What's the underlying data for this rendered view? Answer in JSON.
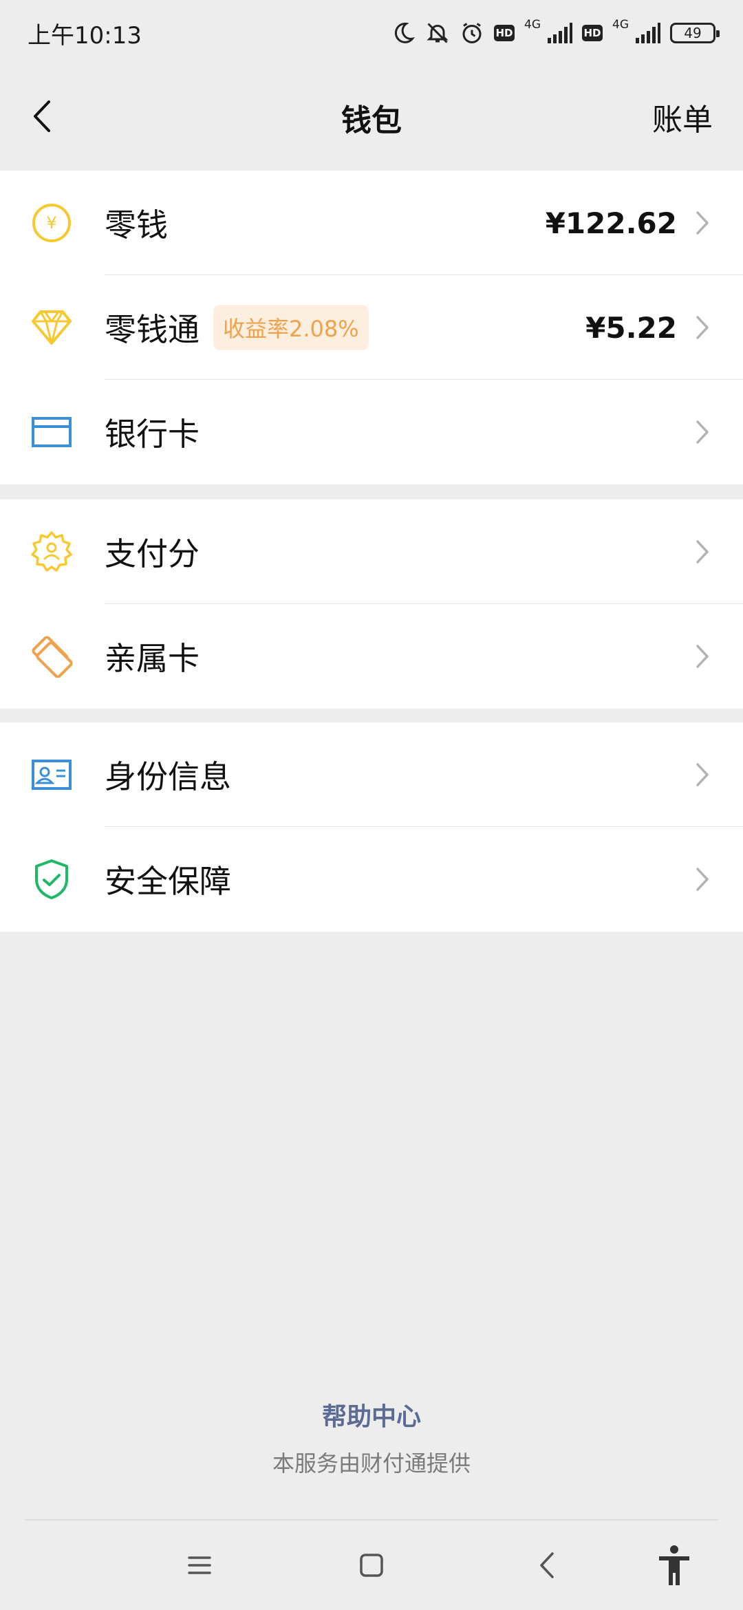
{
  "status_bar": {
    "time": "上午10:13",
    "network_1": "4G",
    "network_2": "4G",
    "hd_1": "HD",
    "hd_2": "HD",
    "battery": "49"
  },
  "header": {
    "title": "钱包",
    "right_link": "账单"
  },
  "group_1": [
    {
      "label": "零钱",
      "value": "¥122.62",
      "icon": "yuan-coin-icon"
    },
    {
      "label": "零钱通",
      "badge": "收益率2.08%",
      "value": "¥5.22",
      "icon": "diamond-icon"
    },
    {
      "label": "银行卡",
      "icon": "bank-card-icon"
    }
  ],
  "group_2": [
    {
      "label": "支付分",
      "icon": "pay-score-icon"
    },
    {
      "label": "亲属卡",
      "icon": "family-card-icon"
    }
  ],
  "group_3": [
    {
      "label": "身份信息",
      "icon": "id-card-icon"
    },
    {
      "label": "安全保障",
      "icon": "shield-check-icon"
    }
  ],
  "footer": {
    "help_center": "帮助中心",
    "provider": "本服务由财付通提供"
  },
  "colors": {
    "background": "#ededed",
    "yellow_icon": "#f7c92e",
    "blue_icon": "#3b8fd9",
    "orange_icon": "#f0a24a",
    "green_icon": "#1fb864",
    "help_link": "#5b6b93",
    "badge_bg": "#fdefe0",
    "badge_text": "#f0a24a"
  }
}
